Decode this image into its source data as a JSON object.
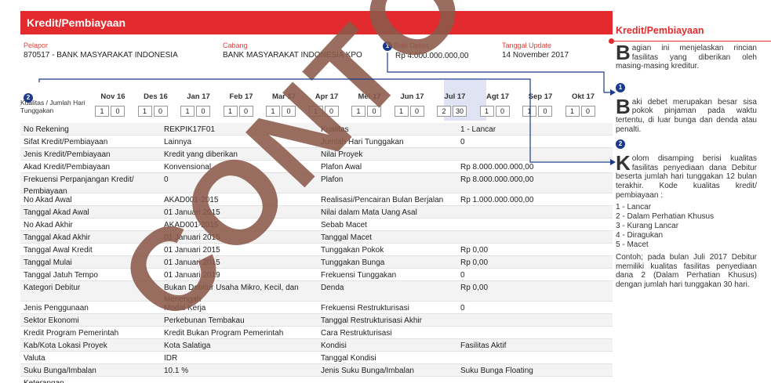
{
  "header": {
    "title": "Kredit/Pembiayaan"
  },
  "info": {
    "pelapor_label": "Pelapor",
    "pelapor_value": "870517 - BANK MASYARAKAT INDONESIA",
    "cabang_label": "Cabang",
    "cabang_value": "BANK MASYARAKAT INDONESIA KPO",
    "baki_label": "Baki Debet",
    "baki_value": "Rp 4.000.000.000,00",
    "tanggal_label": "Tanggal Update",
    "tanggal_value": "14 November 2017",
    "marker1": "1",
    "marker2": "2"
  },
  "kualitas": {
    "label": "Kualitas / Jumlah Hari Tunggakan",
    "months": [
      {
        "m": "Nov 16",
        "k": "1",
        "h": "0"
      },
      {
        "m": "Des 16",
        "k": "1",
        "h": "0"
      },
      {
        "m": "Jan 17",
        "k": "1",
        "h": "0"
      },
      {
        "m": "Feb 17",
        "k": "1",
        "h": "0"
      },
      {
        "m": "Mar 17",
        "k": "1",
        "h": "0"
      },
      {
        "m": "Apr 17",
        "k": "1",
        "h": "0"
      },
      {
        "m": "Mei 17",
        "k": "1",
        "h": "0"
      },
      {
        "m": "Jun 17",
        "k": "1",
        "h": "0"
      },
      {
        "m": "Jul 17",
        "k": "2",
        "h": "30"
      },
      {
        "m": "Agt 17",
        "k": "1",
        "h": "0"
      },
      {
        "m": "Sep 17",
        "k": "1",
        "h": "0"
      },
      {
        "m": "Okt 17",
        "k": "1",
        "h": "0"
      }
    ]
  },
  "rows": [
    [
      "No Rekening",
      "REKPIK17F01",
      "Kualitas",
      "1 - Lancar"
    ],
    [
      "Sifat Kredit/Pembiayaan",
      "Lainnya",
      "Jumlah Hari Tunggakan",
      "0"
    ],
    [
      "Jenis Kredit/Pembiayaan",
      "Kredit yang diberikan",
      "Nilai Proyek",
      ""
    ],
    [
      "Akad Kredit/Pembiayaan",
      "Konvensional",
      "Plafon Awal",
      "Rp 8.000.000.000,00"
    ],
    [
      "Frekuensi Perpanjangan Kredit/ Pembiayaan",
      "0",
      "Plafon",
      "Rp 8.000.000.000,00"
    ],
    [
      "No Akad Awal",
      "AKAD001-2015",
      "Realisasi/Pencairan Bulan Berjalan",
      "Rp 1.000.000.000,00"
    ],
    [
      "Tanggal Akad Awal",
      "01 Januari 2015",
      "Nilai dalam Mata Uang Asal",
      ""
    ],
    [
      "No Akad Akhir",
      "AKAD001-2015",
      "Sebab Macet",
      ""
    ],
    [
      "Tanggal Akad Akhir",
      "01 Januari 2015",
      "Tanggal Macet",
      ""
    ],
    [
      "Tanggal Awal Kredit",
      "01 Januari 2015",
      "Tunggakan Pokok",
      "Rp 0,00"
    ],
    [
      "Tanggal Mulai",
      "01 Januari 2015",
      "Tunggakan Bunga",
      "Rp 0,00"
    ],
    [
      "Tanggal Jatuh Tempo",
      "01 Januari 2019",
      "Frekuensi Tunggakan",
      "0"
    ],
    [
      "Kategori Debitur",
      "Bukan Debitur Usaha Mikro, Kecil, dan Menengah",
      "Denda",
      "Rp 0,00"
    ],
    [
      "Jenis Penggunaan",
      "Modal Kerja",
      "Frekuensi Restrukturisasi",
      "0"
    ],
    [
      "Sektor Ekonomi",
      "Perkebunan Tembakau",
      "Tanggal Restrukturisasi Akhir",
      ""
    ],
    [
      "Kredit Program Pemerintah",
      "Kredit Bukan Program Pemerintah",
      "Cara Restrukturisasi",
      ""
    ],
    [
      "Kab/Kota Lokasi Proyek",
      "Kota Salatiga",
      "Kondisi",
      "Fasilitas Aktif"
    ],
    [
      "Valuta",
      "IDR",
      "Tanggal Kondisi",
      ""
    ],
    [
      "Suku Bunga/Imbalan",
      "10.1 %",
      "Jenis Suku Bunga/Imbalan",
      "Suku Bunga Floating"
    ],
    [
      "Keterangan",
      "",
      "",
      ""
    ]
  ],
  "side": {
    "title": "Kredit/Pembiayaan",
    "intro_cap": "B",
    "intro": "agian ini menjelaskan rincian fasilitas yang diberikan oleh masing-masing kreditur.",
    "m1": "1",
    "p1_cap": "B",
    "p1": "aki debet merupakan besar sisa pokok pinjaman pada waktu tertentu, di luar bunga dan denda atau penalti.",
    "m2": "2",
    "p2_cap": "K",
    "p2": "olom disamping berisi kualitas fasilitas penyediaan dana Debitur beserta jumlah hari tunggakan 12 bulan terakhir. Kode kualitas kredit/ pembiayaan :",
    "codes": [
      "1 - Lancar",
      "2 - Dalam Perhatian Khusus",
      "3 - Kurang Lancar",
      "4 - Diragukan",
      "5 - Macet"
    ],
    "p3": "Contoh; pada bulan Juli 2017 Debitur memiliki kualitas fasilitas penyediaan dana 2 (Dalam Perhatian Khusus) dengan jumlah hari tunggakan 30 hari."
  },
  "watermark": {
    "text": "CONTOH"
  },
  "colors": {
    "accent": "#e32a2e",
    "marker": "#1b3a8c",
    "watermark": "#8b5a4a"
  }
}
